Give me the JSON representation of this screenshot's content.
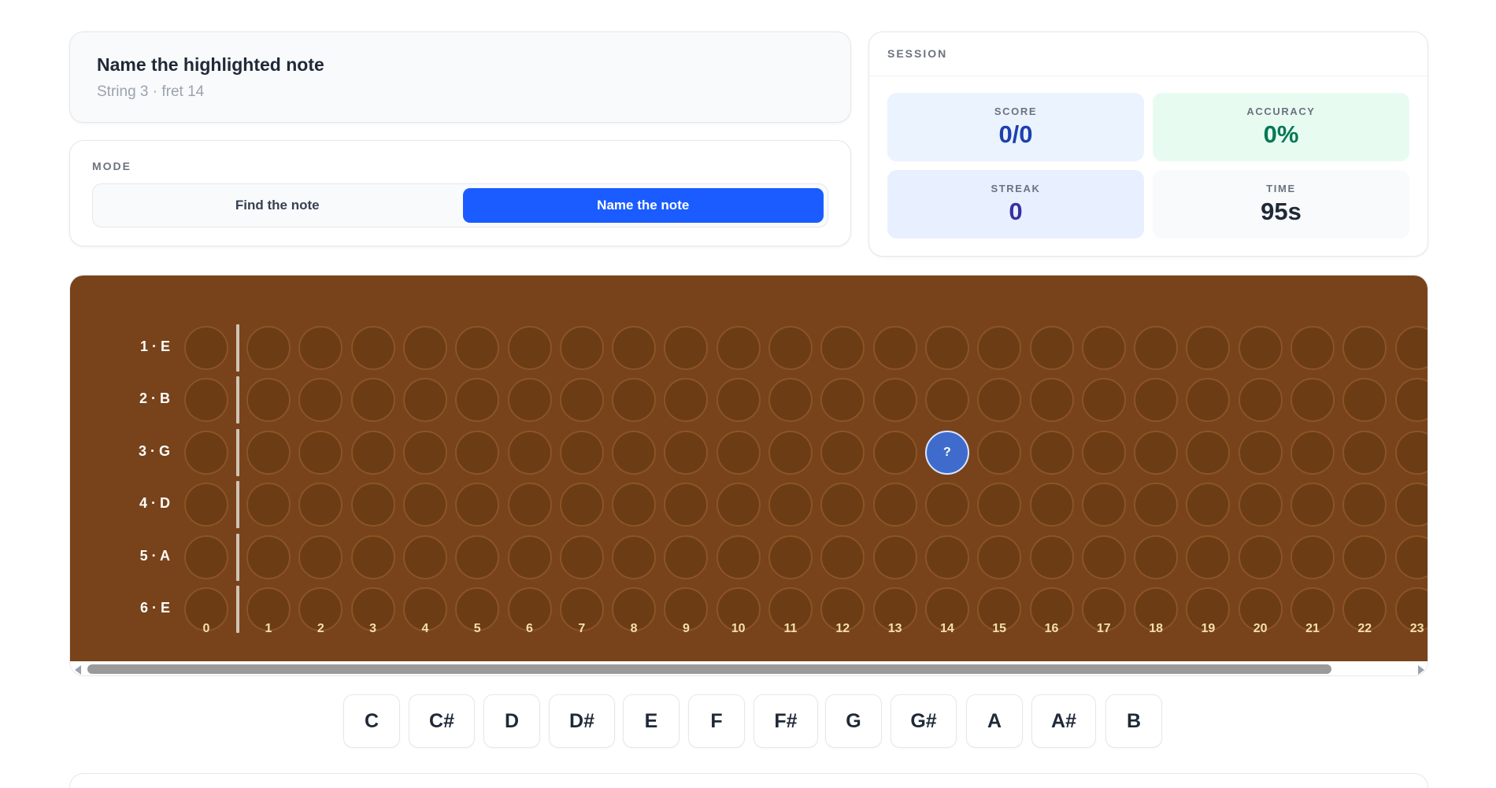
{
  "prompt": {
    "title": "Name the highlighted note",
    "subtitle": "String 3 · fret 14"
  },
  "mode": {
    "label": "MODE",
    "options": [
      {
        "label": "Find the note",
        "active": false
      },
      {
        "label": "Name the note",
        "active": true
      }
    ]
  },
  "session": {
    "label": "SESSION",
    "score": {
      "label": "SCORE",
      "value": "0/0"
    },
    "accuracy": {
      "label": "ACCURACY",
      "value": "0%"
    },
    "streak": {
      "label": "STREAK",
      "value": "0"
    },
    "time": {
      "label": "TIME",
      "value": "95s"
    }
  },
  "fretboard": {
    "strings": [
      "1 · E",
      "2 · B",
      "3 · G",
      "4 · D",
      "5 · A",
      "6 · E"
    ],
    "frets": [
      "0",
      "1",
      "2",
      "3",
      "4",
      "5",
      "6",
      "7",
      "8",
      "9",
      "10",
      "11",
      "12",
      "13",
      "14",
      "15",
      "16",
      "17",
      "18",
      "19",
      "20",
      "21",
      "22",
      "23"
    ],
    "highlight": {
      "string": 3,
      "fret": 14,
      "marker": "?"
    },
    "colors": {
      "wood": "#78431a",
      "cell": "#6c3c15",
      "highlight": "#3f6ccc"
    }
  },
  "notes": [
    "C",
    "C#",
    "D",
    "D#",
    "E",
    "F",
    "F#",
    "G",
    "G#",
    "A",
    "A#",
    "B"
  ]
}
